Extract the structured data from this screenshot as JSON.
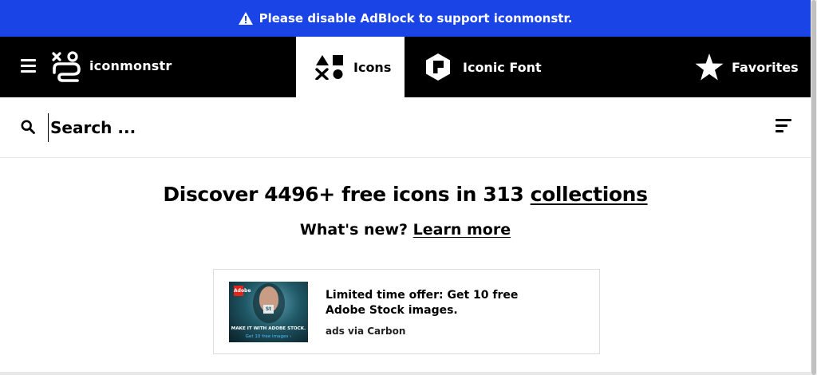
{
  "banner": {
    "text": "Please disable AdBlock to support iconmonstr.",
    "icon": "warning-icon",
    "color": "#1a44e6"
  },
  "topnav": {
    "menu_icon": "hamburger-icon",
    "logo_text": "iconmonstr",
    "tabs": [
      {
        "label": "Icons",
        "icon": "shapes-icon",
        "active": true
      },
      {
        "label": "Iconic Font",
        "icon": "iconic-font-icon",
        "active": false
      },
      {
        "label": "Favorites",
        "icon": "star-icon",
        "active": false
      }
    ]
  },
  "search": {
    "placeholder": "Search ...",
    "value": "",
    "icon": "search-icon",
    "filter_icon": "filter-icon"
  },
  "main": {
    "headline_prefix": "Discover 4496+ free icons in 313 ",
    "headline_link": "collections",
    "subline_prefix": "What's new? ",
    "subline_link": "Learn more"
  },
  "ad": {
    "logo_text": "Adobe",
    "badge_text": "St",
    "image_caption": "MAKE IT WITH ADOBE STOCK.",
    "image_subcaption": "Get 10 free images ›",
    "offer_text": "Limited time offer: Get 10 free Adobe Stock images.",
    "via_text": "ads via Carbon"
  }
}
